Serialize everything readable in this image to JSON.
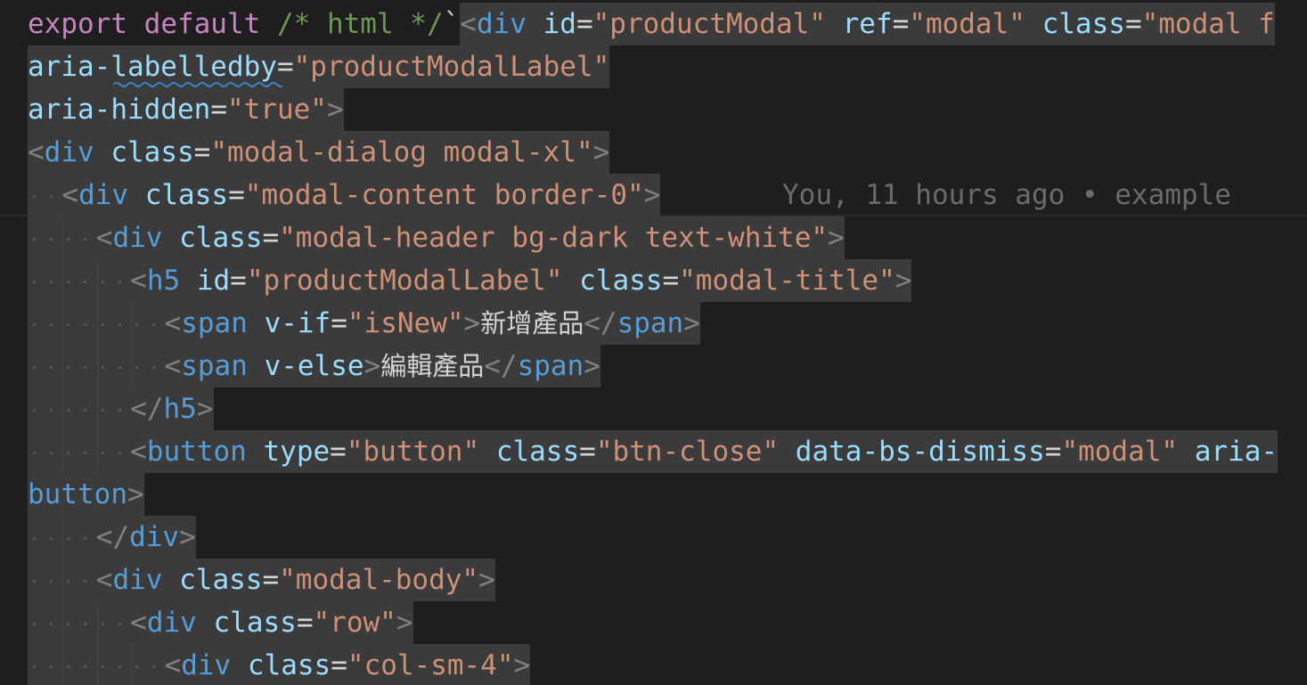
{
  "editor": {
    "colors": {
      "background": "#1e1e1e",
      "selection": "#3b3b3b",
      "keyword": "#c586c0",
      "comment": "#6a9955",
      "tag": "#569cd6",
      "attribute": "#9cdcfe",
      "string": "#ce9178",
      "punctuation": "#808080",
      "text": "#d4d4d4",
      "blame": "#6b6b6b"
    },
    "blame": "You, 11 hours ago • example",
    "lines": [
      {
        "indent": 0,
        "segments": [
          {
            "t": "export",
            "c": "keyword",
            "sel": false
          },
          {
            "t": " ",
            "c": "text",
            "sel": false
          },
          {
            "t": "default",
            "c": "keyword",
            "sel": false
          },
          {
            "t": " ",
            "c": "text",
            "sel": false
          },
          {
            "t": "/* html */",
            "c": "comment",
            "sel": false
          },
          {
            "t": "`",
            "c": "text",
            "sel": false
          },
          {
            "t": "<",
            "c": "punctuation",
            "sel": true
          },
          {
            "t": "div",
            "c": "tag",
            "sel": true
          },
          {
            "t": " ",
            "c": "text",
            "sel": true
          },
          {
            "t": "id",
            "c": "attribute",
            "sel": true
          },
          {
            "t": "=",
            "c": "text",
            "sel": true
          },
          {
            "t": "\"productModal\"",
            "c": "string",
            "sel": true
          },
          {
            "t": " ",
            "c": "text",
            "sel": true
          },
          {
            "t": "ref",
            "c": "attribute",
            "sel": true
          },
          {
            "t": "=",
            "c": "text",
            "sel": true
          },
          {
            "t": "\"modal\"",
            "c": "string",
            "sel": true
          },
          {
            "t": " ",
            "c": "text",
            "sel": true
          },
          {
            "t": "class",
            "c": "attribute",
            "sel": true
          },
          {
            "t": "=",
            "c": "text",
            "sel": true
          },
          {
            "t": "\"modal f",
            "c": "string",
            "sel": true
          }
        ]
      },
      {
        "indent": 0,
        "segments": [
          {
            "t": "aria-labelledby",
            "c": "attribute",
            "sel": true
          },
          {
            "t": "=",
            "c": "text",
            "sel": true
          },
          {
            "t": "\"productModalLabel\"",
            "c": "string",
            "sel": true
          }
        ]
      },
      {
        "indent": 0,
        "segments": [
          {
            "t": "aria-hidden",
            "c": "attribute",
            "sel": true
          },
          {
            "t": "=",
            "c": "text",
            "sel": true
          },
          {
            "t": "\"true\"",
            "c": "string",
            "sel": true
          },
          {
            "t": ">",
            "c": "punctuation",
            "sel": true
          }
        ]
      },
      {
        "indent": 0,
        "segments": [
          {
            "t": "<",
            "c": "punctuation",
            "sel": true
          },
          {
            "t": "div",
            "c": "tag",
            "sel": true
          },
          {
            "t": " ",
            "c": "text",
            "sel": true
          },
          {
            "t": "class",
            "c": "attribute",
            "sel": true
          },
          {
            "t": "=",
            "c": "text",
            "sel": true
          },
          {
            "t": "\"modal-dialog modal-xl\"",
            "c": "string",
            "sel": true
          },
          {
            "t": ">",
            "c": "punctuation",
            "sel": true
          }
        ]
      },
      {
        "indent": 1,
        "segments": [
          {
            "t": "<",
            "c": "punctuation",
            "sel": true
          },
          {
            "t": "div",
            "c": "tag",
            "sel": true
          },
          {
            "t": " ",
            "c": "text",
            "sel": true
          },
          {
            "t": "class",
            "c": "attribute",
            "sel": true
          },
          {
            "t": "=",
            "c": "text",
            "sel": true
          },
          {
            "t": "\"modal-content border-0\"",
            "c": "string",
            "sel": true
          },
          {
            "t": ">",
            "c": "punctuation",
            "sel": true
          }
        ]
      },
      {
        "indent": 2,
        "segments": [
          {
            "t": "<",
            "c": "punctuation",
            "sel": true
          },
          {
            "t": "div",
            "c": "tag",
            "sel": true
          },
          {
            "t": " ",
            "c": "text",
            "sel": true
          },
          {
            "t": "class",
            "c": "attribute",
            "sel": true
          },
          {
            "t": "=",
            "c": "text",
            "sel": true
          },
          {
            "t": "\"modal-header bg-dark text-white\"",
            "c": "string",
            "sel": true
          },
          {
            "t": ">",
            "c": "punctuation",
            "sel": true
          }
        ]
      },
      {
        "indent": 3,
        "segments": [
          {
            "t": "<",
            "c": "punctuation",
            "sel": true
          },
          {
            "t": "h5",
            "c": "tag",
            "sel": true
          },
          {
            "t": " ",
            "c": "text",
            "sel": true
          },
          {
            "t": "id",
            "c": "attribute",
            "sel": true
          },
          {
            "t": "=",
            "c": "text",
            "sel": true
          },
          {
            "t": "\"productModalLabel\"",
            "c": "string",
            "sel": true
          },
          {
            "t": " ",
            "c": "text",
            "sel": true
          },
          {
            "t": "class",
            "c": "attribute",
            "sel": true
          },
          {
            "t": "=",
            "c": "text",
            "sel": true
          },
          {
            "t": "\"modal-title\"",
            "c": "string",
            "sel": true
          },
          {
            "t": ">",
            "c": "punctuation",
            "sel": true
          }
        ]
      },
      {
        "indent": 4,
        "segments": [
          {
            "t": "<",
            "c": "punctuation",
            "sel": true
          },
          {
            "t": "span",
            "c": "tag",
            "sel": true
          },
          {
            "t": " ",
            "c": "text",
            "sel": true
          },
          {
            "t": "v-if",
            "c": "attribute",
            "sel": true
          },
          {
            "t": "=",
            "c": "text",
            "sel": true
          },
          {
            "t": "\"isNew\"",
            "c": "string",
            "sel": true
          },
          {
            "t": ">",
            "c": "punctuation",
            "sel": true
          },
          {
            "t": "新增產品",
            "c": "text",
            "sel": true,
            "cjk": true
          },
          {
            "t": "</",
            "c": "punctuation",
            "sel": true
          },
          {
            "t": "span",
            "c": "tag",
            "sel": true
          },
          {
            "t": ">",
            "c": "punctuation",
            "sel": true
          }
        ]
      },
      {
        "indent": 4,
        "segments": [
          {
            "t": "<",
            "c": "punctuation",
            "sel": true
          },
          {
            "t": "span",
            "c": "tag",
            "sel": true
          },
          {
            "t": " ",
            "c": "text",
            "sel": true
          },
          {
            "t": "v-else",
            "c": "attribute",
            "sel": true
          },
          {
            "t": ">",
            "c": "punctuation",
            "sel": true
          },
          {
            "t": "編輯產品",
            "c": "text",
            "sel": true,
            "cjk": true
          },
          {
            "t": "</",
            "c": "punctuation",
            "sel": true
          },
          {
            "t": "span",
            "c": "tag",
            "sel": true
          },
          {
            "t": ">",
            "c": "punctuation",
            "sel": true
          }
        ]
      },
      {
        "indent": 3,
        "segments": [
          {
            "t": "</",
            "c": "punctuation",
            "sel": true
          },
          {
            "t": "h5",
            "c": "tag",
            "sel": true
          },
          {
            "t": ">",
            "c": "punctuation",
            "sel": true
          }
        ]
      },
      {
        "indent": 3,
        "segments": [
          {
            "t": "<",
            "c": "punctuation",
            "sel": true
          },
          {
            "t": "button",
            "c": "tag",
            "sel": true
          },
          {
            "t": " ",
            "c": "text",
            "sel": true
          },
          {
            "t": "type",
            "c": "attribute",
            "sel": true
          },
          {
            "t": "=",
            "c": "text",
            "sel": true
          },
          {
            "t": "\"button\"",
            "c": "string",
            "sel": true
          },
          {
            "t": " ",
            "c": "text",
            "sel": true
          },
          {
            "t": "class",
            "c": "attribute",
            "sel": true
          },
          {
            "t": "=",
            "c": "text",
            "sel": true
          },
          {
            "t": "\"btn-close\"",
            "c": "string",
            "sel": true
          },
          {
            "t": " ",
            "c": "text",
            "sel": true
          },
          {
            "t": "data-bs-dismiss",
            "c": "attribute",
            "sel": true
          },
          {
            "t": "=",
            "c": "text",
            "sel": true
          },
          {
            "t": "\"modal\"",
            "c": "string",
            "sel": true
          },
          {
            "t": " ",
            "c": "text",
            "sel": true
          },
          {
            "t": "aria-",
            "c": "attribute",
            "sel": true
          }
        ]
      },
      {
        "indent": 0,
        "segments": [
          {
            "t": "button",
            "c": "tag",
            "sel": true
          },
          {
            "t": ">",
            "c": "punctuation",
            "sel": true
          }
        ]
      },
      {
        "indent": 2,
        "segments": [
          {
            "t": "</",
            "c": "punctuation",
            "sel": true
          },
          {
            "t": "div",
            "c": "tag",
            "sel": true
          },
          {
            "t": ">",
            "c": "punctuation",
            "sel": true
          }
        ]
      },
      {
        "indent": 2,
        "segments": [
          {
            "t": "<",
            "c": "punctuation",
            "sel": true
          },
          {
            "t": "div",
            "c": "tag",
            "sel": true
          },
          {
            "t": " ",
            "c": "text",
            "sel": true
          },
          {
            "t": "class",
            "c": "attribute",
            "sel": true
          },
          {
            "t": "=",
            "c": "text",
            "sel": true
          },
          {
            "t": "\"modal-body\"",
            "c": "string",
            "sel": true
          },
          {
            "t": ">",
            "c": "punctuation",
            "sel": true
          }
        ]
      },
      {
        "indent": 3,
        "segments": [
          {
            "t": "<",
            "c": "punctuation",
            "sel": true
          },
          {
            "t": "div",
            "c": "tag",
            "sel": true
          },
          {
            "t": " ",
            "c": "text",
            "sel": true
          },
          {
            "t": "class",
            "c": "attribute",
            "sel": true
          },
          {
            "t": "=",
            "c": "text",
            "sel": true
          },
          {
            "t": "\"row\"",
            "c": "string",
            "sel": true
          },
          {
            "t": ">",
            "c": "punctuation",
            "sel": true
          }
        ]
      },
      {
        "indent": 4,
        "segments": [
          {
            "t": "<",
            "c": "punctuation",
            "sel": true
          },
          {
            "t": "div",
            "c": "tag",
            "sel": true
          },
          {
            "t": " ",
            "c": "text",
            "sel": true
          },
          {
            "t": "class",
            "c": "attribute",
            "sel": true
          },
          {
            "t": "=",
            "c": "text",
            "sel": true
          },
          {
            "t": "\"col-sm-4\"",
            "c": "string",
            "sel": true
          },
          {
            "t": ">",
            "c": "punctuation",
            "sel": true
          }
        ]
      }
    ]
  }
}
